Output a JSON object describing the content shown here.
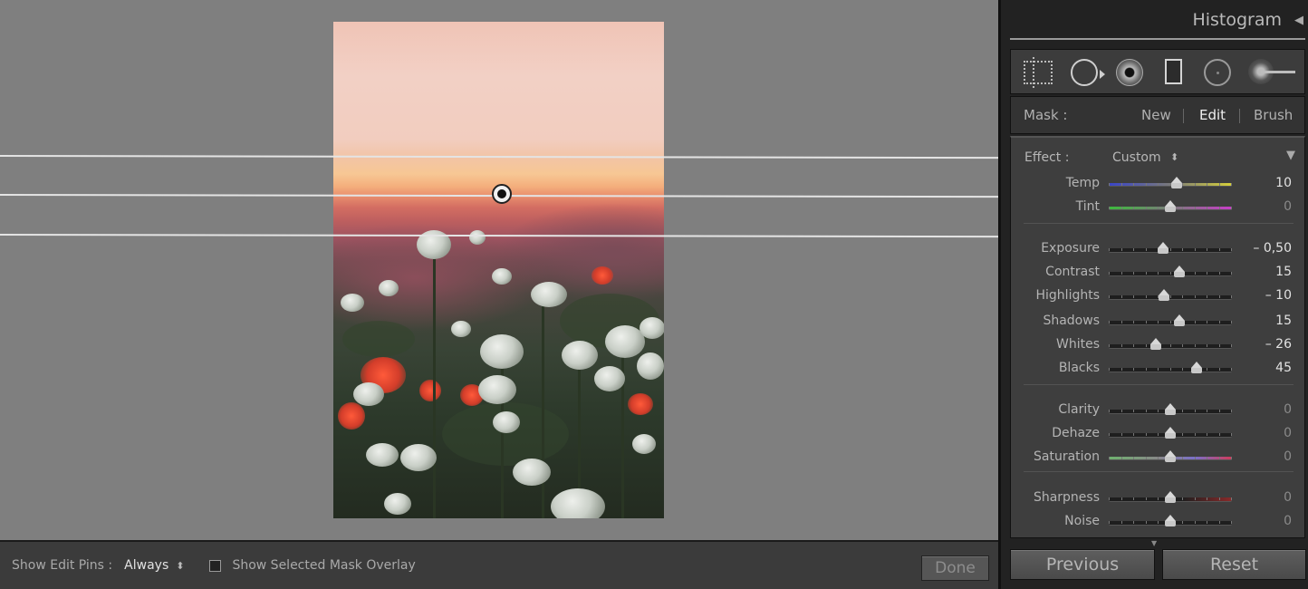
{
  "panel": {
    "histogram_title": "Histogram",
    "mask": {
      "label": "Mask :",
      "new": "New",
      "edit": "Edit",
      "brush": "Brush"
    },
    "effect": {
      "label": "Effect :",
      "value": "Custom"
    },
    "sliders": [
      {
        "key": "temp",
        "label": "Temp",
        "value": "10",
        "position": 0.55,
        "dim": false
      },
      {
        "key": "tint",
        "label": "Tint",
        "value": "0",
        "position": 0.5,
        "dim": true
      },
      {
        "key": "exposure",
        "label": "Exposure",
        "value": "– 0,50",
        "position": 0.44,
        "dim": false
      },
      {
        "key": "contrast",
        "label": "Contrast",
        "value": "15",
        "position": 0.57,
        "dim": false
      },
      {
        "key": "highlights",
        "label": "Highlights",
        "value": "– 10",
        "position": 0.45,
        "dim": false
      },
      {
        "key": "shadows",
        "label": "Shadows",
        "value": "15",
        "position": 0.57,
        "dim": false
      },
      {
        "key": "whites",
        "label": "Whites",
        "value": "– 26",
        "position": 0.38,
        "dim": false
      },
      {
        "key": "blacks",
        "label": "Blacks",
        "value": "45",
        "position": 0.71,
        "dim": false
      },
      {
        "key": "clarity",
        "label": "Clarity",
        "value": "0",
        "position": 0.5,
        "dim": true
      },
      {
        "key": "dehaze",
        "label": "Dehaze",
        "value": "0",
        "position": 0.5,
        "dim": true
      },
      {
        "key": "saturation",
        "label": "Saturation",
        "value": "0",
        "position": 0.5,
        "dim": true
      },
      {
        "key": "sharpness",
        "label": "Sharpness",
        "value": "0",
        "position": 0.5,
        "dim": true
      },
      {
        "key": "noise",
        "label": "Noise",
        "value": "0",
        "position": 0.5,
        "dim": true
      }
    ],
    "tools": [
      "crop-overlay-icon",
      "spot-removal-icon",
      "red-eye-icon",
      "graduated-filter-icon",
      "radial-filter-icon",
      "adjustment-brush-icon"
    ],
    "previous_button": "Previous",
    "reset_button": "Reset"
  },
  "toolbar": {
    "show_pins_label": "Show Edit Pins :",
    "show_pins_value": "Always",
    "overlay_label": "Show Selected Mask Overlay",
    "overlay_checked": false,
    "done_button": "Done"
  },
  "colors": {
    "canvas_bg": "#7f7f7f",
    "panel_bg": "#3e3e3e",
    "temp_gradient": [
      "#3a45c8",
      "#d6d03a"
    ],
    "tint_gradient": [
      "#3dba3d",
      "#c83dc8"
    ],
    "sat_gradient": [
      "#888888",
      "#d03a5a"
    ]
  }
}
